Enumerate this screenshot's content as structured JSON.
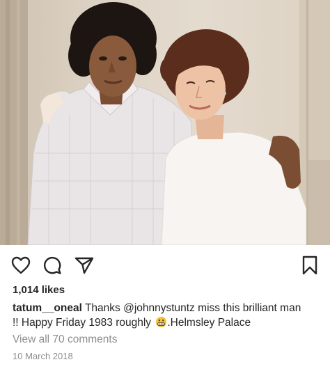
{
  "post": {
    "likes": "1,014 likes",
    "caption": {
      "username": "tatum__oneal",
      "text_before_mention": " Thanks ",
      "mention": "@johnnystuntz",
      "text_line1_after": " miss this brilliant man",
      "text_line2": "!! Happy Friday 1983 roughly ",
      "text_after_emoji": ".Helmsley Palace",
      "emoji": "grimacing-face"
    },
    "view_comments": "View all 70 comments",
    "date": "10 March 2018"
  },
  "icons": {
    "like": "heart-outline-icon",
    "comment": "speech-bubble-icon",
    "share": "paper-plane-icon",
    "save": "bookmark-outline-icon"
  },
  "colors": {
    "text": "#262626",
    "muted": "#8e8e8e",
    "mention": "#262626"
  }
}
